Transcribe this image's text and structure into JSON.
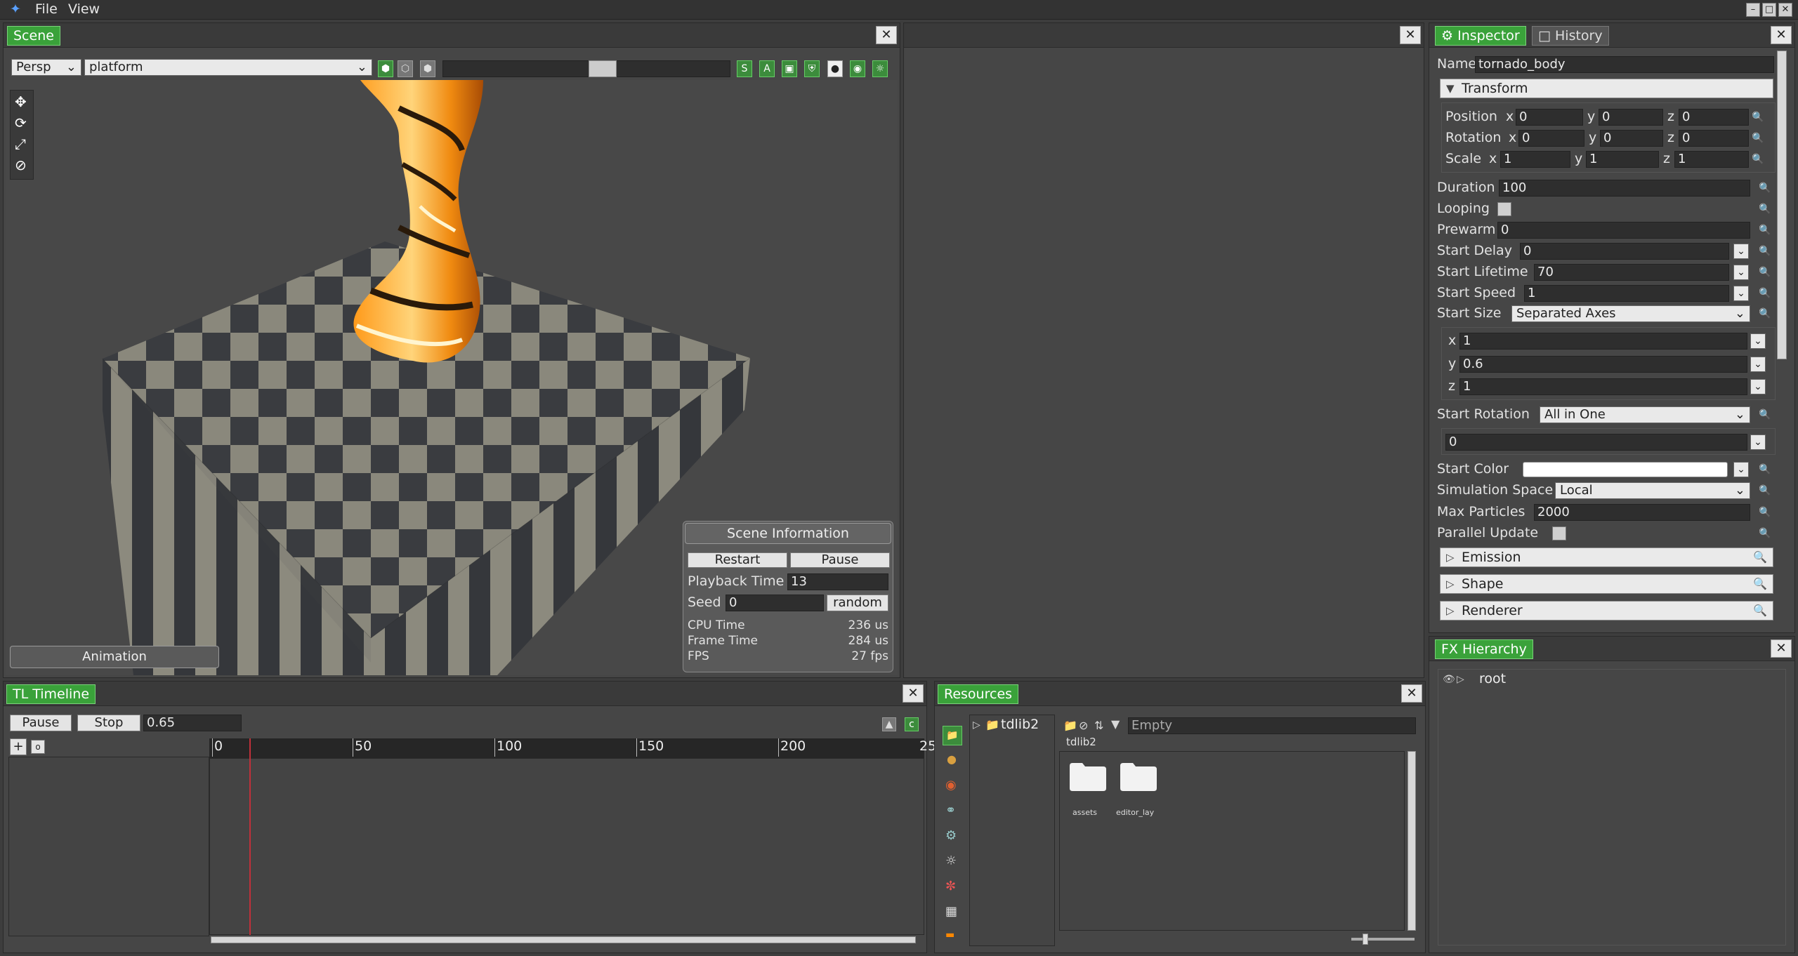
{
  "menu": {
    "file": "File",
    "view": "View"
  },
  "window_buttons": [
    "–",
    "□",
    "✕"
  ],
  "scene": {
    "tab": "Scene",
    "camera_mode": "Persp",
    "object_select": "platform",
    "gizmo_icons": [
      "move-gizmo-icon",
      "rotate-gizmo-icon",
      "scale-gizmo-icon",
      "snap-off-icon"
    ],
    "toolbar_icons_left": [
      "solid-cube-icon",
      "wire-cube-icon",
      "shaded-cube-icon"
    ],
    "toolbar_letters": [
      "S",
      "A"
    ],
    "toolbar_icons_right": [
      "box-icon",
      "shield-icon",
      "sphere-icon",
      "light-bulb-icon",
      "sun-icon"
    ],
    "animation_button": "Animation",
    "info": {
      "title": "Scene Information",
      "restart": "Restart",
      "pause": "Pause",
      "playback_label": "Playback Time",
      "playback_value": "13",
      "seed_label": "Seed",
      "seed_value": "0",
      "random": "random",
      "cpu_label": "CPU Time",
      "cpu_value": "236 us",
      "frame_label": "Frame Time",
      "frame_value": "284 us",
      "fps_label": "FPS",
      "fps_value": "27 fps"
    }
  },
  "timeline": {
    "tab": "TL Timeline",
    "pause": "Pause",
    "stop": "Stop",
    "time_value": "0.65",
    "add": "+",
    "ticks": [
      "0",
      "50",
      "100",
      "150",
      "200",
      "25"
    ]
  },
  "resources": {
    "tab": "Resources",
    "tree_root": "tdlib2",
    "path": "tdlib2",
    "filter_placeholder": "Empty",
    "items": [
      {
        "name": "assets"
      },
      {
        "name": "editor_lay"
      }
    ],
    "side_icons": [
      "folder-icon",
      "material-icon",
      "palette-icon",
      "globe-icon",
      "shader-icon",
      "settings-icon",
      "color-wheel-icon",
      "texture-icon",
      "gradient-icon"
    ]
  },
  "inspector": {
    "tab": "Inspector",
    "history_tab": "History",
    "name_label": "Name",
    "name_value": "tornado_body",
    "transform": {
      "header": "Transform",
      "rows": [
        {
          "label": "Position",
          "x": "0",
          "y": "0",
          "z": "0"
        },
        {
          "label": "Rotation",
          "x": "0",
          "y": "0",
          "z": "0"
        },
        {
          "label": "Scale",
          "x": "1",
          "y": "1",
          "z": "1"
        }
      ],
      "axis_x": "x",
      "axis_y": "y",
      "axis_z": "z"
    },
    "props": {
      "duration_label": "Duration",
      "duration": "100",
      "looping_label": "Looping",
      "prewarm_label": "Prewarm",
      "prewarm": "0",
      "start_delay_label": "Start Delay",
      "start_delay": "0",
      "start_lifetime_label": "Start Lifetime",
      "start_lifetime": "70",
      "start_speed_label": "Start Speed",
      "start_speed": "1",
      "start_size_label": "Start Size",
      "start_size_mode": "Separated Axes",
      "size_x_label": "x",
      "size_x": "1",
      "size_y_label": "y",
      "size_y": "0.6",
      "size_z_label": "z",
      "size_z": "1",
      "start_rotation_label": "Start Rotation",
      "start_rotation_mode": "All in One",
      "start_rotation_value": "0",
      "start_color_label": "Start Color",
      "sim_space_label": "Simulation Space",
      "sim_space": "Local",
      "max_particles_label": "Max Particles",
      "max_particles": "2000",
      "parallel_label": "Parallel Update"
    },
    "sections": [
      "Emission",
      "Shape",
      "Renderer"
    ]
  },
  "fx_hierarchy": {
    "tab": "FX Hierarchy",
    "root": "root"
  }
}
